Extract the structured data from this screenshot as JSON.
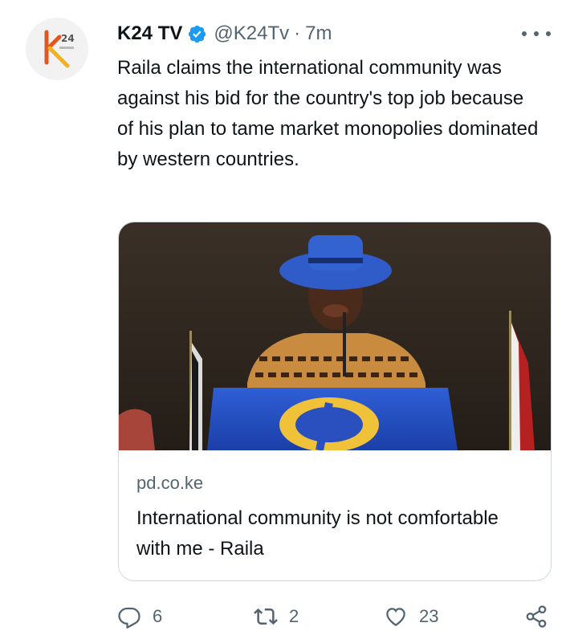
{
  "account": {
    "display_name": "K24 TV",
    "handle": "@K24Tv",
    "separator": "·",
    "time": "7m",
    "avatar_icon": "k24-logo-icon"
  },
  "tweet": {
    "text": "Raila claims the international community was against his bid for the country's top job because of his plan to tame market monopolies dominated by western countries."
  },
  "card": {
    "domain": "pd.co.ke",
    "title": "International community is not comfortable with me - Raila"
  },
  "actions": {
    "replies": "6",
    "retweets": "2",
    "likes": "23"
  },
  "colors": {
    "verified": "#1d9bf0",
    "secondary_text": "#536471",
    "border": "#cfd9de"
  }
}
